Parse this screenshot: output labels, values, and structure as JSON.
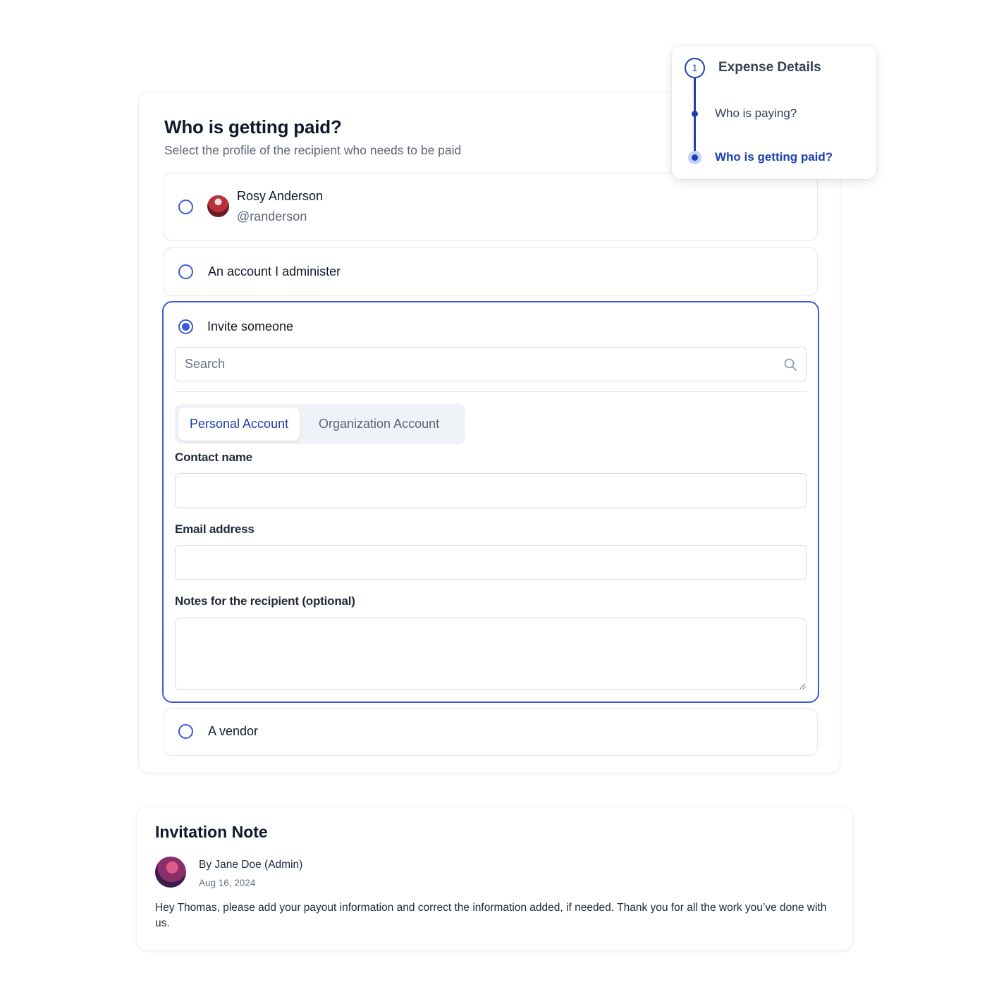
{
  "main": {
    "title": "Who is getting paid?",
    "subtitle": "Select the profile of the recipient who needs to be paid"
  },
  "options": {
    "rosy": {
      "name": "Rosy Anderson",
      "handle": "@randerson"
    },
    "admin": {
      "label": "An account I administer"
    },
    "invite": {
      "label": "Invite someone",
      "search_placeholder": "Search",
      "tabs": [
        "Personal Account",
        "Organization Account"
      ],
      "active_tab": "Personal Account",
      "contact_name_label": "Contact name",
      "contact_name_value": "",
      "email_label": "Email address",
      "email_value": "",
      "notes_label": "Notes for the recipient (optional)",
      "notes_value": ""
    },
    "vendor": {
      "label": "A vendor"
    },
    "selected": "invite"
  },
  "stepper": {
    "step_number": "1",
    "title": "Expense Details",
    "items": [
      "Who is paying?",
      "Who is getting paid?"
    ],
    "current": "Who is getting paid?"
  },
  "note": {
    "title": "Invitation Note",
    "author": "By Jane Doe (Admin)",
    "date": "Aug 16, 2024",
    "body": "Hey Thomas, please add your payout information and correct the information added, if needed. Thank you for all the work you’ve done with us."
  },
  "colors": {
    "accent": "#3b5bdb",
    "accent_dark": "#1e40af",
    "border": "#e4e7ec",
    "muted_text": "#5b6578"
  },
  "icons": {
    "search": "search-icon",
    "step": "step-number-icon"
  }
}
